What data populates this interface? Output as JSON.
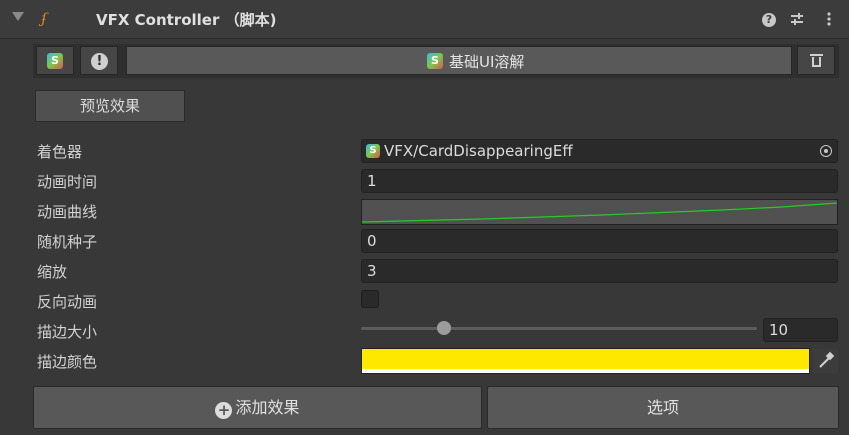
{
  "header": {
    "title": "VFX Controller （脚本)",
    "icons": [
      "fold-arrow-icon",
      "script-icon",
      "help-icon",
      "presets-icon",
      "kebab-menu-icon"
    ]
  },
  "effect_row": {
    "script_icon_letter": "S",
    "warning_glyph": "!",
    "effect_name": "基础UI溶解",
    "icons": [
      "s-script-icon",
      "warning-icon",
      "trash-icon"
    ]
  },
  "preview_button": "预览效果",
  "properties": {
    "shader": {
      "label": "着色器",
      "value": "VFX/CardDisappearingEff",
      "icon_letter": "S"
    },
    "duration": {
      "label": "动画时间",
      "value": "1"
    },
    "curve": {
      "label": "动画曲线",
      "curve_color": "#1fd11f"
    },
    "seed": {
      "label": "随机种子",
      "value": "0"
    },
    "scale": {
      "label": "缩放",
      "value": "3"
    },
    "reverse": {
      "label": "反向动画",
      "checked": false
    },
    "outline_size": {
      "label": "描边大小",
      "value": "10",
      "slider_fraction": 0.21
    },
    "outline_color": {
      "label": "描边颜色",
      "color": "#ffe800"
    }
  },
  "buttons": {
    "add_effect": "添加效果",
    "add_effect_icon": "+",
    "options": "选项"
  },
  "theme": {
    "background": "#383838",
    "field": "#2a2a2a",
    "accent_script": "#e58a1f"
  }
}
